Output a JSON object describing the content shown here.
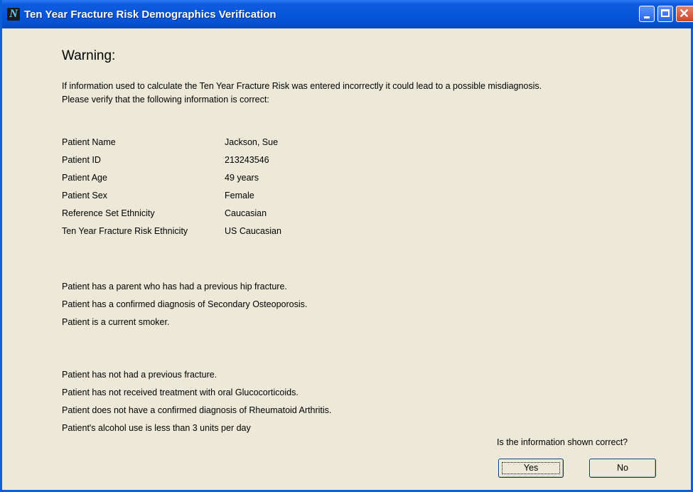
{
  "window": {
    "title": "Ten Year Fracture Risk Demographics Verification"
  },
  "heading": "Warning:",
  "intro": [
    "If information used to calculate the Ten Year Fracture Risk was entered incorrectly it could lead to a possible misdiagnosis.",
    "Please verify that the following information is correct:"
  ],
  "details": [
    {
      "label": "Patient Name",
      "value": "Jackson, Sue"
    },
    {
      "label": "Patient ID",
      "value": "213243546"
    },
    {
      "label": "Patient Age",
      "value": "49 years"
    },
    {
      "label": "Patient Sex",
      "value": "Female"
    },
    {
      "label": "Reference Set Ethnicity",
      "value": "Caucasian"
    },
    {
      "label": "Ten Year Fracture Risk Ethnicity",
      "value": "US Caucasian"
    }
  ],
  "risk_factors_present": [
    "Patient has a parent who has had a previous hip fracture.",
    "Patient has a confirmed diagnosis of Secondary Osteoporosis.",
    "Patient is a current smoker."
  ],
  "risk_factors_absent": [
    "Patient has not had a previous fracture.",
    "Patient has not received treatment with oral Glucocorticoids.",
    "Patient does not have a confirmed diagnosis of Rheumatoid Arthritis.",
    "Patient's alcohol use is less than 3 units per day"
  ],
  "question": "Is the information shown correct?",
  "buttons": {
    "yes": "Yes",
    "no": "No"
  },
  "colors": {
    "titlebar": "#0655D9",
    "dialog_bg": "#ECE9D8",
    "close_button": "#C8462A"
  }
}
